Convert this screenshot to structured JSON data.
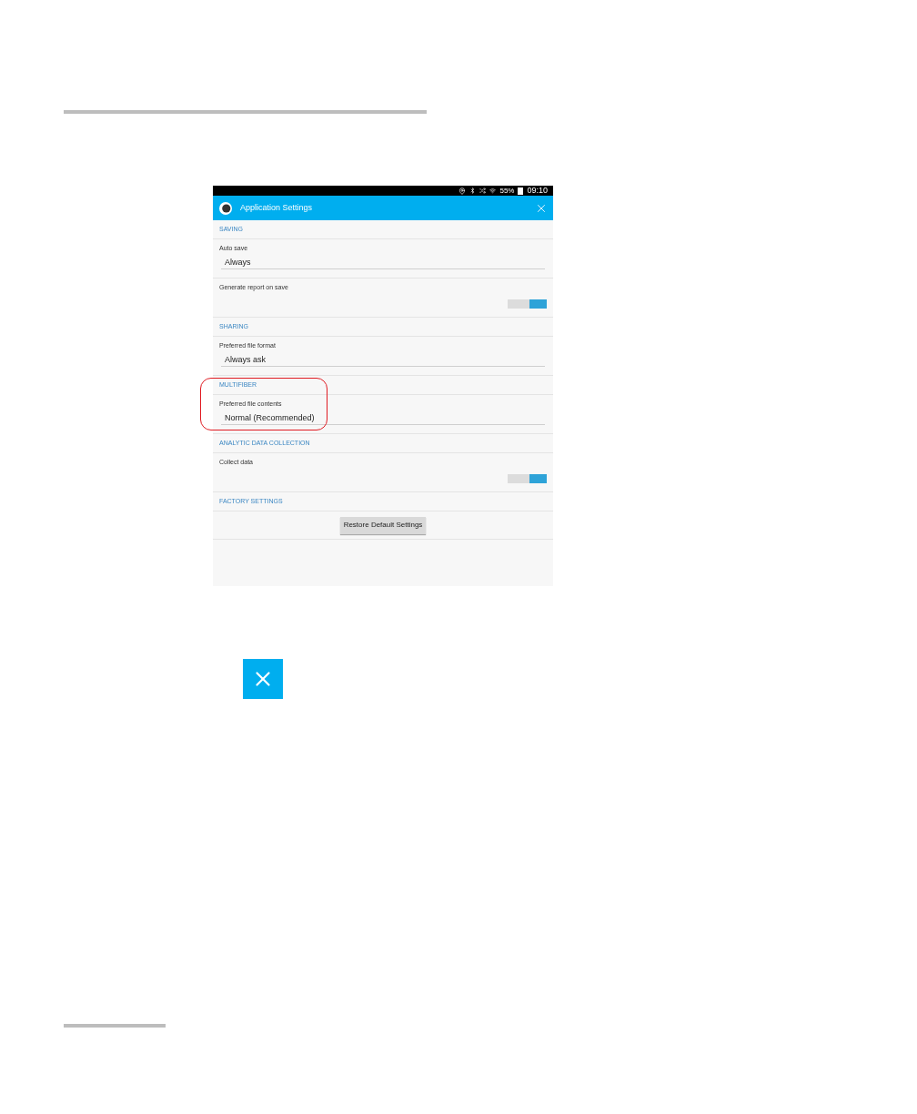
{
  "status_bar": {
    "battery_percent": "55%",
    "time": "09:10"
  },
  "app_bar": {
    "title": "Application Settings"
  },
  "sections": [
    {
      "title": "SAVING",
      "highlighted": false,
      "items": [
        {
          "kind": "dropdown",
          "label": "Auto save",
          "value": "Always"
        },
        {
          "kind": "toggle",
          "label": "Generate report on save",
          "on": true
        }
      ]
    },
    {
      "title": "SHARING",
      "highlighted": false,
      "items": [
        {
          "kind": "dropdown",
          "label": "Preferred file format",
          "value": "Always ask"
        }
      ]
    },
    {
      "title": "MULTIFIBER",
      "highlighted": true,
      "items": [
        {
          "kind": "dropdown",
          "label": "Preferred file contents",
          "value": "Normal (Recommended)"
        }
      ]
    },
    {
      "title": "ANALYTIC DATA COLLECTION",
      "highlighted": false,
      "items": [
        {
          "kind": "toggle",
          "label": "Collect data",
          "on": true
        }
      ]
    },
    {
      "title": "FACTORY SETTINGS",
      "highlighted": false,
      "items": [
        {
          "kind": "button",
          "label": "Restore Default Settings"
        }
      ]
    }
  ]
}
